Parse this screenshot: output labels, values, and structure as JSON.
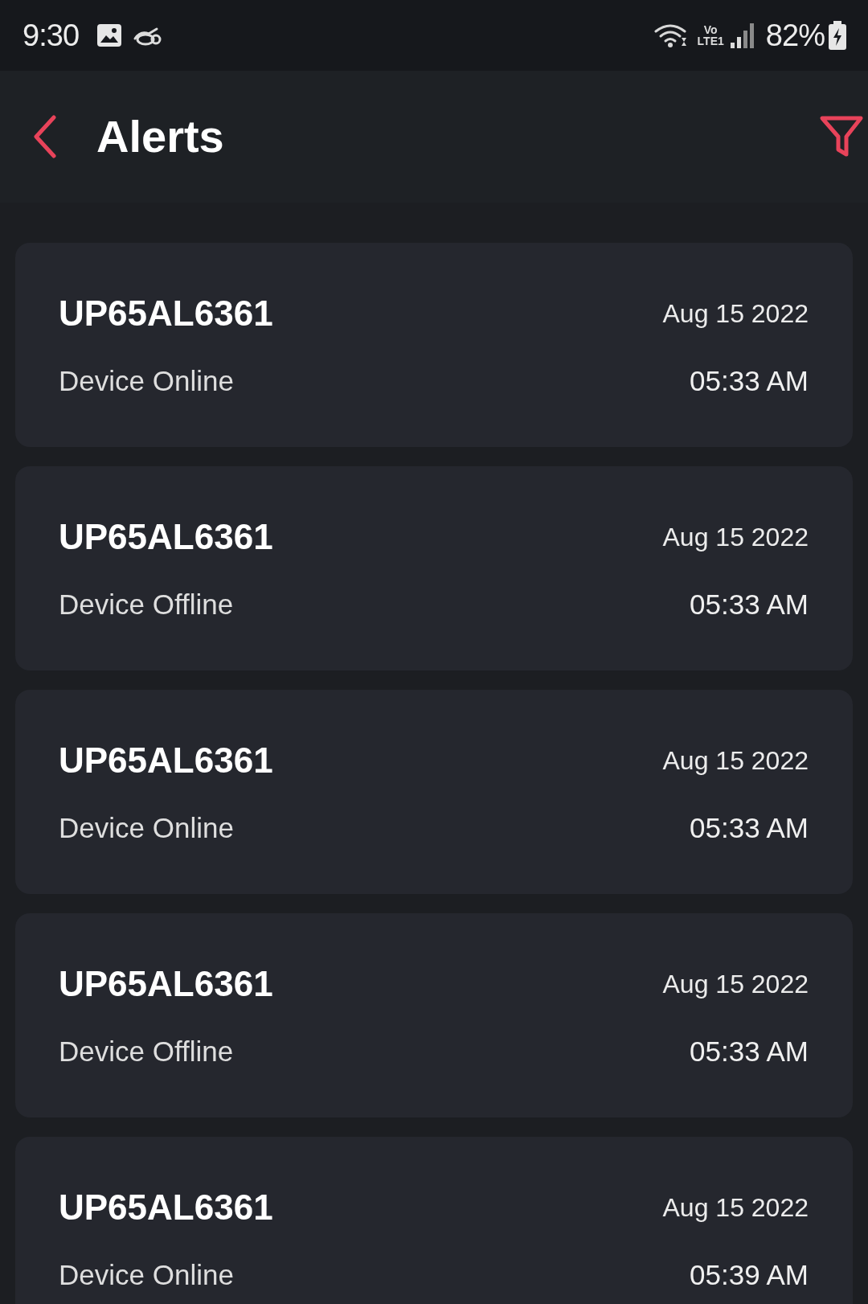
{
  "status_bar": {
    "time": "9:30",
    "volte_top": "Vo",
    "volte_bottom": "LTE1",
    "battery": "82%",
    "charging": true
  },
  "header": {
    "title": "Alerts"
  },
  "alerts": [
    {
      "plate": "UP65AL6361",
      "date": "Aug 15 2022",
      "status": "Device Online",
      "time": "05:33 AM"
    },
    {
      "plate": "UP65AL6361",
      "date": "Aug 15 2022",
      "status": "Device Offline",
      "time": "05:33 AM"
    },
    {
      "plate": "UP65AL6361",
      "date": "Aug 15 2022",
      "status": "Device Online",
      "time": "05:33 AM"
    },
    {
      "plate": "UP65AL6361",
      "date": "Aug 15 2022",
      "status": "Device Offline",
      "time": "05:33 AM"
    },
    {
      "plate": "UP65AL6361",
      "date": "Aug 15 2022",
      "status": "Device Online",
      "time": "05:39 AM"
    }
  ]
}
